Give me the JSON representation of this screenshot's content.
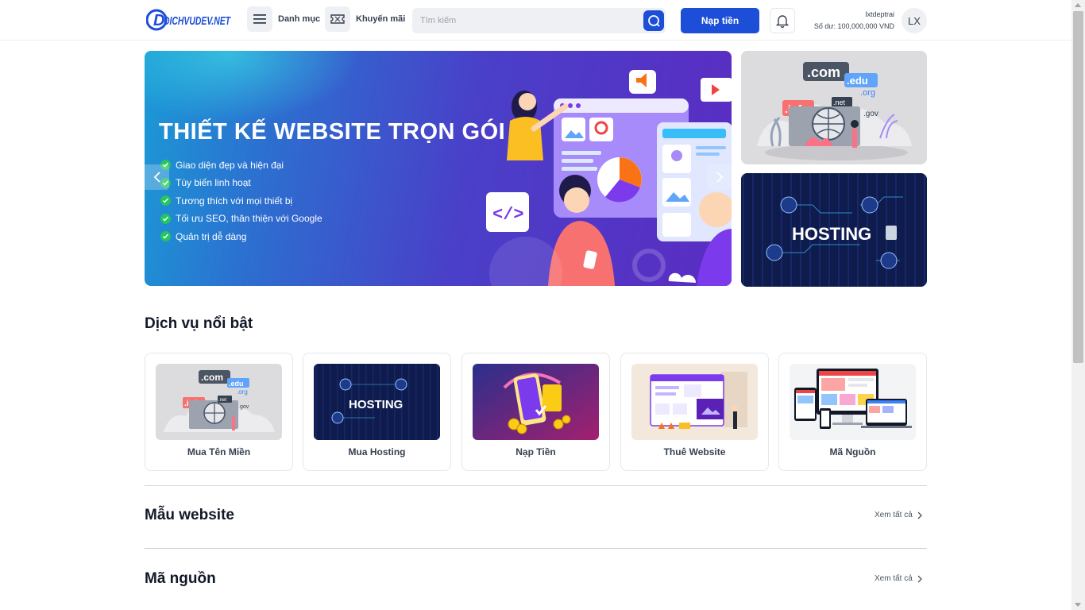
{
  "header": {
    "logo_text": "DICHVUDEV.NET",
    "menu_label": "Danh mục",
    "promo_label": "Khuyến mãi",
    "search_placeholder": "Tìm kiếm",
    "topup_label": "Nạp tiền",
    "username": "lxtdeptrai",
    "balance": "Số dư: 100,000,000 VND",
    "avatar_initials": "LX"
  },
  "hero": {
    "title": "THIẾT KẾ WEBSITE TRỌN GÓI",
    "bullets": [
      "Giao diện đẹp và hiện đại",
      "Tùy biến linh hoạt",
      "Tương thích với mọi thiết bị",
      "Tối ưu SEO, thân thiện với Google",
      "Quản trị dễ dàng"
    ]
  },
  "side_banners": {
    "domains": [
      ".com",
      ".edu",
      ".org",
      ".info",
      ".net",
      ".gov"
    ],
    "hosting": "HOSTING"
  },
  "featured": {
    "title": "Dịch vụ nổi bật",
    "items": [
      {
        "label": "Mua Tên Miền",
        "icon": "domain-illustration"
      },
      {
        "label": "Mua Hosting",
        "icon": "hosting-illustration"
      },
      {
        "label": "Nạp Tiền",
        "icon": "topup-illustration"
      },
      {
        "label": "Thuê Website",
        "icon": "website-illustration"
      },
      {
        "label": "Mã Nguồn",
        "icon": "source-code-illustration"
      }
    ]
  },
  "templates": {
    "title": "Mẫu website",
    "see_all": "Xem tất cả"
  },
  "sources": {
    "title": "Mã nguồn",
    "see_all": "Xem tất cả"
  },
  "colors": {
    "primary": "#1d4ed8",
    "check": "#22c55e",
    "hosting_bg": "#13225c",
    "topup_bg": "#7a1f86"
  }
}
